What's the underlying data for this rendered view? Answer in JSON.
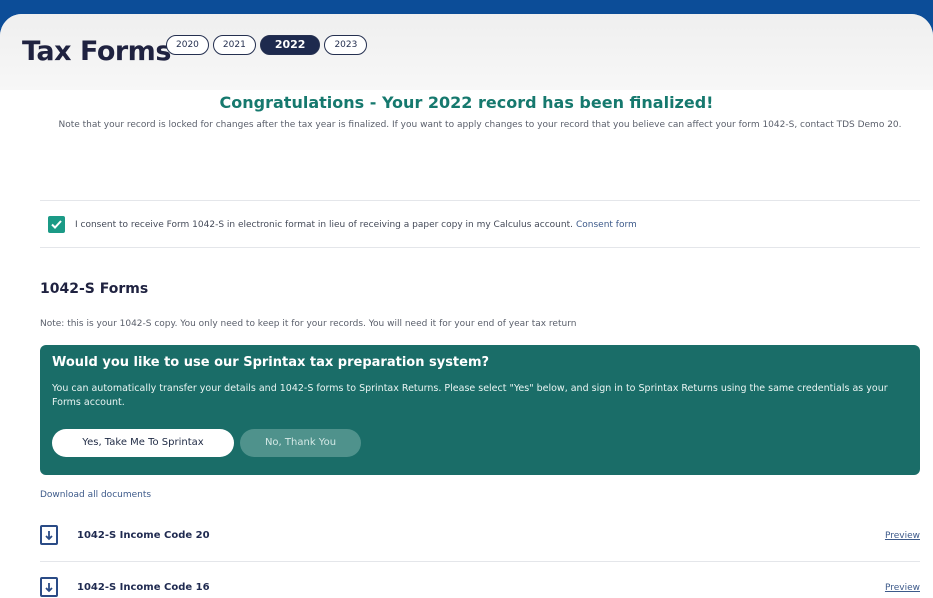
{
  "page": {
    "title": "Tax Forms",
    "years": [
      "2020",
      "2021",
      "2022",
      "2023"
    ],
    "selected_year": "2022"
  },
  "banner": {
    "heading": "Congratulations - Your 2022 record has been finalized!",
    "note": "Note that your record is locked for changes after the tax year is finalized. If you want to apply changes to your record that you believe can affect your form 1042-S, contact TDS Demo 20."
  },
  "consent": {
    "checked": true,
    "text": "I consent to receive Form 1042-S in electronic format in lieu of receiving a paper copy in my Calculus account.",
    "link_label": "Consent form"
  },
  "forms_section": {
    "title": "1042-S Forms",
    "note": "Note: this is your 1042-S copy. You only need to keep it for your records. You will need it for your end of year tax return"
  },
  "promo": {
    "title": "Would you like to use our Sprintax tax preparation system?",
    "text": "You can automatically transfer your details and 1042-S forms to Sprintax Returns. Please select \"Yes\" below, and sign in to Sprintax Returns using the same credentials as your Forms account.",
    "yes_label": "Yes, Take Me To Sprintax",
    "no_label": "No, Thank You"
  },
  "documents": {
    "download_all_label": "Download all documents",
    "items": [
      {
        "name": "1042-S Income Code 20",
        "action": "Preview"
      },
      {
        "name": "1042-S Income Code 16",
        "action": "Preview"
      }
    ]
  },
  "colors": {
    "background": "#0c4d98",
    "accent_teal": "#1a6d68",
    "heading_green": "#16796e",
    "dark_navy": "#1e2a4e"
  }
}
